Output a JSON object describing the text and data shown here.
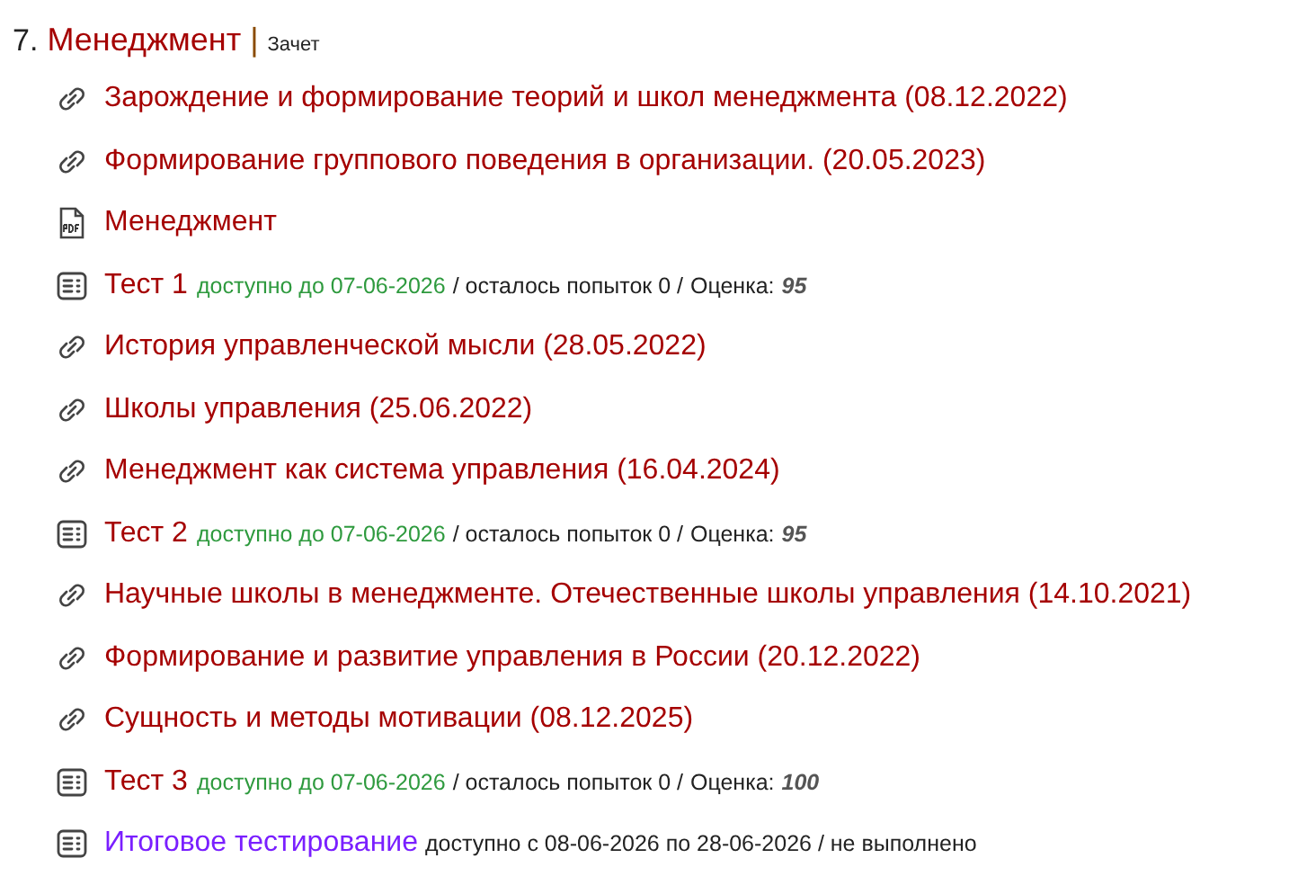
{
  "section": {
    "number": "7.",
    "title": "Менеджмент",
    "separator": "|",
    "type": "Зачет"
  },
  "items": [
    {
      "kind": "link",
      "title": "Зарождение и формирование теорий и школ менеджмента (08.12.2022)"
    },
    {
      "kind": "link",
      "title": "Формирование группового поведения в организации. (20.05.2023)"
    },
    {
      "kind": "pdf",
      "title": "Менеджмент"
    },
    {
      "kind": "test",
      "title": "Тест 1",
      "availability": "доступно до 07-06-2026",
      "attempts": "/ осталось попыток 0 /",
      "grade_label": "Оценка:",
      "grade": "95"
    },
    {
      "kind": "link",
      "title": "История управленческой мысли (28.05.2022)"
    },
    {
      "kind": "link",
      "title": "Школы управления (25.06.2022)"
    },
    {
      "kind": "link",
      "title": "Менеджмент как система управления (16.04.2024)"
    },
    {
      "kind": "test",
      "title": "Тест 2",
      "availability": "доступно до 07-06-2026",
      "attempts": "/ осталось попыток 0 /",
      "grade_label": "Оценка:",
      "grade": "95"
    },
    {
      "kind": "link",
      "title": "Научные школы в менеджменте. Отечественные школы управления (14.10.2021)"
    },
    {
      "kind": "link",
      "title": "Формирование и развитие управления в России (20.12.2022)"
    },
    {
      "kind": "link",
      "title": "Сущность и методы мотивации (08.12.2025)"
    },
    {
      "kind": "test",
      "title": "Тест 3",
      "availability": "доступно до 07-06-2026",
      "attempts": "/ осталось попыток 0 /",
      "grade_label": "Оценка:",
      "grade": "100"
    },
    {
      "kind": "final",
      "title": "Итоговое тестирование",
      "status": "доступно с 08-06-2026 по 28-06-2026 / не выполнено"
    }
  ]
}
